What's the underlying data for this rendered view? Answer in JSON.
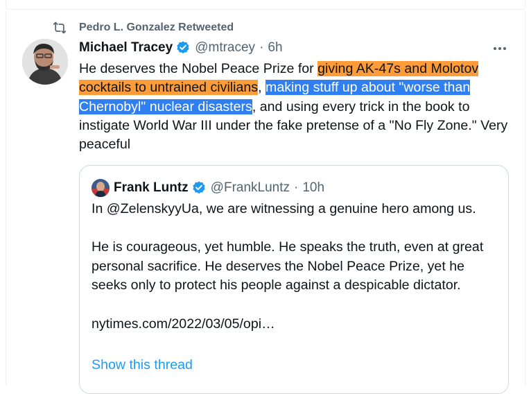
{
  "retweet": {
    "label": "Pedro L. Gonzalez Retweeted",
    "icon": "retweet-icon"
  },
  "tweet": {
    "name": "Michael Tracey",
    "handle": "@mtracey",
    "separator": "·",
    "time": "6h",
    "text": {
      "part1": "He deserves the Nobel Peace Prize for ",
      "highlight1": "giving AK-47s and Molotov cocktails to untrained civilians",
      "part2": ", ",
      "highlight2": "making stuff up about \"worse than Chernobyl\" nuclear disasters",
      "part3": ", and using every trick in the book to instigate World War III under the fake pretense of a \"No Fly Zone.\" Very peaceful"
    },
    "highlight_colors": {
      "orange": "#ff9c3a",
      "blue": "#2f7ff0"
    }
  },
  "quoted": {
    "name": "Frank Luntz",
    "handle": "@FrankLuntz",
    "separator": "·",
    "time": "10h",
    "paragraph1": "In @ZelenskyyUa, we are witnessing a genuine hero among us.",
    "paragraph2": "He is courageous, yet humble.  He speaks the truth, even at great personal sacrifice.  He deserves the Nobel Peace Prize, yet he seeks only to protect his people against a despicable dictator.",
    "link": "nytimes.com/2022/03/05/opi…",
    "show_thread": "Show this thread"
  },
  "colors": {
    "verified": "#1d9bf0",
    "secondary_text": "#536471",
    "link": "#1d9bf0"
  }
}
